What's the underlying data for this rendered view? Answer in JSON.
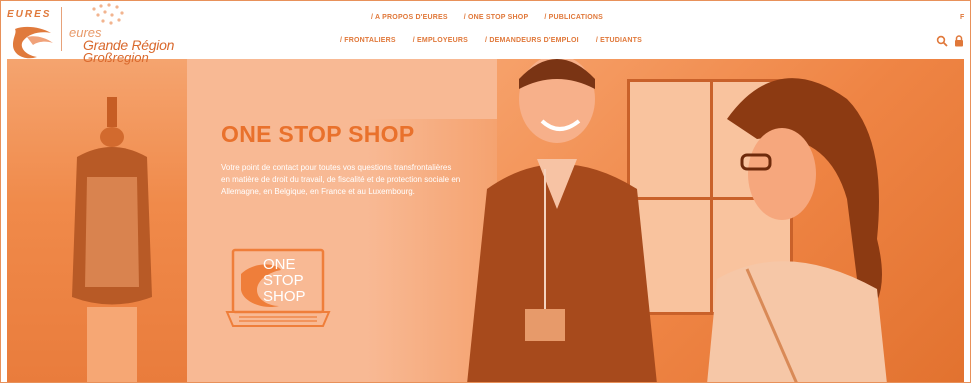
{
  "logo": {
    "eures_label": "EURES",
    "eures_small": "eures",
    "region_line1": "Grande Région",
    "region_line2": "Großregion"
  },
  "nav": {
    "top": [
      "/ A PROPOS D'EURES",
      "/ ONE STOP SHOP",
      "/ PUBLICATIONS"
    ],
    "bottom": [
      "/ FRONTALIERS",
      "/ EMPLOYEURS",
      "/ DEMANDEURS D'EMPLOI",
      "/ ETUDIANTS"
    ],
    "lang": "F"
  },
  "icons": {
    "search": "search-icon",
    "lock": "lock-icon"
  },
  "hero": {
    "title": "ONE STOP SHOP",
    "text": "Votre point de contact pour toutes vos questions transfrontalières en matière de droit du travail, de fiscalité et de protection sociale en Allemagne, en Belgique, en France et au Luxembourg.",
    "logo_lines": [
      "ONE",
      "STOP",
      "SHOP"
    ]
  },
  "colors": {
    "accent": "#e9712c",
    "overlay": "#f28d4d"
  }
}
